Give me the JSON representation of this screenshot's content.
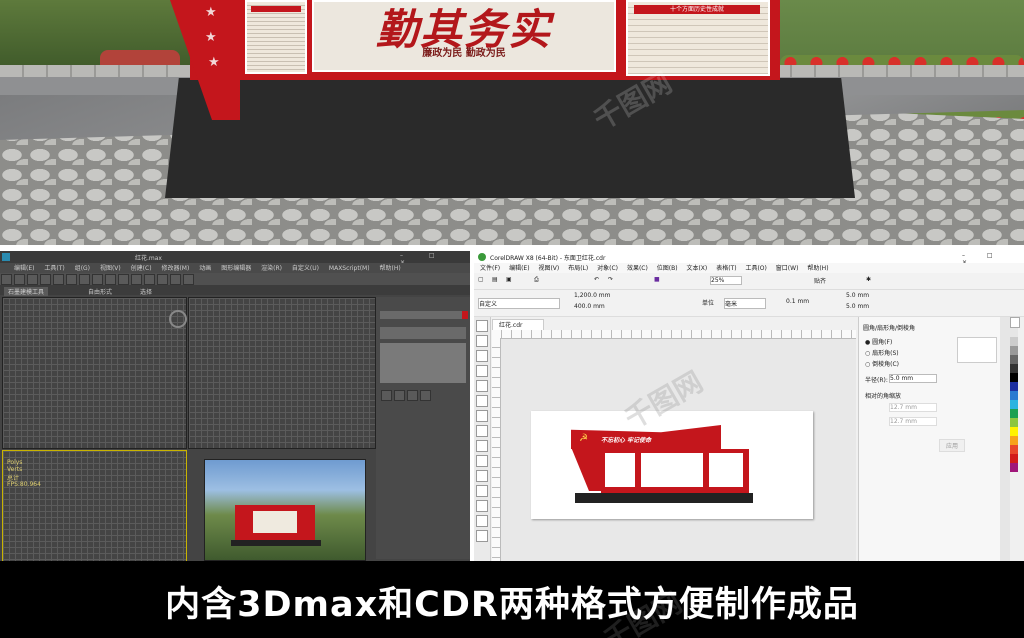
{
  "scene": {
    "board_title": "勤其务实",
    "board_slogan": "廉政为民  勤政为民",
    "right_panel_heading": "十个方面历史性成就"
  },
  "max_window": {
    "title": "红花.max",
    "menu": [
      "编辑(E)",
      "工具(T)",
      "组(G)",
      "视图(V)",
      "创建(C)",
      "修改器(M)",
      "动画",
      "图形编辑器",
      "渲染(R)",
      "自定义(U)",
      "MAXScript(M)",
      "帮助(H)"
    ],
    "ribbon_tabs": [
      "石墨建模工具",
      "自由形式",
      "选择"
    ],
    "viewport_stats": "FPS:80.964",
    "viewport_badge": "Polys\nVerts\n总计"
  },
  "cdr_window": {
    "title": "CorelDRAW X8 (64-Bit) - 东面卫红花.cdr",
    "menu": [
      "文件(F)",
      "编辑(E)",
      "视图(V)",
      "布局(L)",
      "对象(C)",
      "效果(C)",
      "位图(B)",
      "文本(X)",
      "表格(T)",
      "工具(O)",
      "窗口(W)",
      "帮助(H)"
    ],
    "zoom": "25%",
    "snap_label": "贴齐",
    "preset": "自定义",
    "width_value": "1,200.0 mm",
    "height_value": "400.0 mm",
    "unit_label": "单位",
    "unit_value": "毫米",
    "nudge_value": "0.1 mm",
    "dup_x": "5.0 mm",
    "dup_y": "5.0 mm",
    "doc_tab": "红花.cdr",
    "canvas_headline": "不忘初心 牢记使命",
    "panel_title": "圆角/扇形角/倒棱角",
    "panel_options": [
      "圆角(F)",
      "扇形角(S)",
      "倒棱角(C)"
    ],
    "radius_label": "半径(R):",
    "radius_value": "5.0 mm",
    "corner_label": "相对的角缩放",
    "corner_values": [
      "12.7 mm",
      "12.7 mm"
    ],
    "apply_label": "应用"
  },
  "caption": "内含3Dmax和CDR两种格式方便制作成品",
  "colors": {
    "board_red": "#c4161c",
    "caption_text": "#ffffff"
  }
}
